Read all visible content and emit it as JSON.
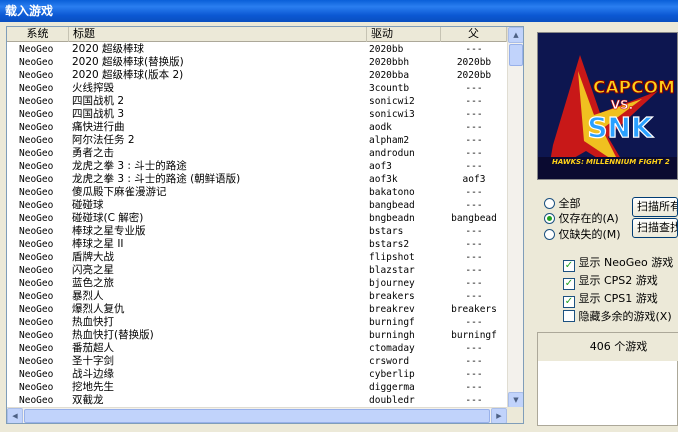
{
  "window": {
    "title": "载入游戏"
  },
  "columns": {
    "system": "系统",
    "title": "标题",
    "driver": "驱动",
    "parent": "父"
  },
  "rows": [
    {
      "system": "NeoGeo",
      "title": "2020 超级棒球",
      "driver": "2020bb",
      "parent": "---"
    },
    {
      "system": "NeoGeo",
      "title": "2020 超级棒球(替换版)",
      "driver": "2020bbh",
      "parent": "2020bb"
    },
    {
      "system": "NeoGeo",
      "title": "2020 超级棒球(版本 2)",
      "driver": "2020bba",
      "parent": "2020bb"
    },
    {
      "system": "NeoGeo",
      "title": "火线搾毁",
      "driver": "3countb",
      "parent": "---"
    },
    {
      "system": "NeoGeo",
      "title": "四国战机 2",
      "driver": "sonicwi2",
      "parent": "---"
    },
    {
      "system": "NeoGeo",
      "title": "四国战机 3",
      "driver": "sonicwi3",
      "parent": "---"
    },
    {
      "system": "NeoGeo",
      "title": "痛快进行曲",
      "driver": "aodk",
      "parent": "---"
    },
    {
      "system": "NeoGeo",
      "title": "阿尔法任务 2",
      "driver": "alpham2",
      "parent": "---"
    },
    {
      "system": "NeoGeo",
      "title": "勇者之击",
      "driver": "androdun",
      "parent": "---"
    },
    {
      "system": "NeoGeo",
      "title": "龙虎之拳 3 : 斗士的路途",
      "driver": "aof3",
      "parent": "---"
    },
    {
      "system": "NeoGeo",
      "title": "龙虎之拳 3 : 斗士的路途 (朝鲜语版)",
      "driver": "aof3k",
      "parent": "aof3"
    },
    {
      "system": "NeoGeo",
      "title": "傻瓜殿下麻雀漫游记",
      "driver": "bakatono",
      "parent": "---"
    },
    {
      "system": "NeoGeo",
      "title": "碰碰球",
      "driver": "bangbead",
      "parent": "---"
    },
    {
      "system": "NeoGeo",
      "title": "碰碰球(C 解密)",
      "driver": "bngbeadn",
      "parent": "bangbead"
    },
    {
      "system": "NeoGeo",
      "title": "棒球之星专业版",
      "driver": "bstars",
      "parent": "---"
    },
    {
      "system": "NeoGeo",
      "title": "棒球之星 II",
      "driver": "bstars2",
      "parent": "---"
    },
    {
      "system": "NeoGeo",
      "title": "盾牌大战",
      "driver": "flipshot",
      "parent": "---"
    },
    {
      "system": "NeoGeo",
      "title": "闪亮之星",
      "driver": "blazstar",
      "parent": "---"
    },
    {
      "system": "NeoGeo",
      "title": "蓝色之旅",
      "driver": "bjourney",
      "parent": "---"
    },
    {
      "system": "NeoGeo",
      "title": "暴烈人",
      "driver": "breakers",
      "parent": "---"
    },
    {
      "system": "NeoGeo",
      "title": "爆烈人复仇",
      "driver": "breakrev",
      "parent": "breakers"
    },
    {
      "system": "NeoGeo",
      "title": "热血快打",
      "driver": "burningf",
      "parent": "---"
    },
    {
      "system": "NeoGeo",
      "title": "热血快打(替换版)",
      "driver": "burningh",
      "parent": "burningf"
    },
    {
      "system": "NeoGeo",
      "title": "番茄超人",
      "driver": "ctomaday",
      "parent": "---"
    },
    {
      "system": "NeoGeo",
      "title": "圣十字剑",
      "driver": "crsword",
      "parent": "---"
    },
    {
      "system": "NeoGeo",
      "title": "战斗边缘",
      "driver": "cyberlip",
      "parent": "---"
    },
    {
      "system": "NeoGeo",
      "title": "挖地先生",
      "driver": "diggerma",
      "parent": "---"
    },
    {
      "system": "NeoGeo",
      "title": "双截龙",
      "driver": "doubledr",
      "parent": "---"
    }
  ],
  "preview": {
    "logo_top": "CAPCOM",
    "logo_vs": "VS.",
    "logo_bottom": "SNK",
    "subtitle": "MILLENNIUM FIGHT 2",
    "tag": "HAWKS:"
  },
  "filters": {
    "all": "全部",
    "existing": "仅存在的(A)",
    "missing": "仅缺失的(M)",
    "selected": "existing"
  },
  "buttons": {
    "scan_all": "扫描所有",
    "scan_search": "扫描查找"
  },
  "show_options": [
    {
      "label": "显示 NeoGeo 游戏",
      "checked": true
    },
    {
      "label": "显示 CPS2 游戏",
      "checked": true
    },
    {
      "label": "显示 CPS1 游戏",
      "checked": true
    },
    {
      "label": "隐藏多余的游戏(X)",
      "checked": false
    }
  ],
  "status": {
    "count": "406",
    "count_suffix": "个游戏"
  }
}
